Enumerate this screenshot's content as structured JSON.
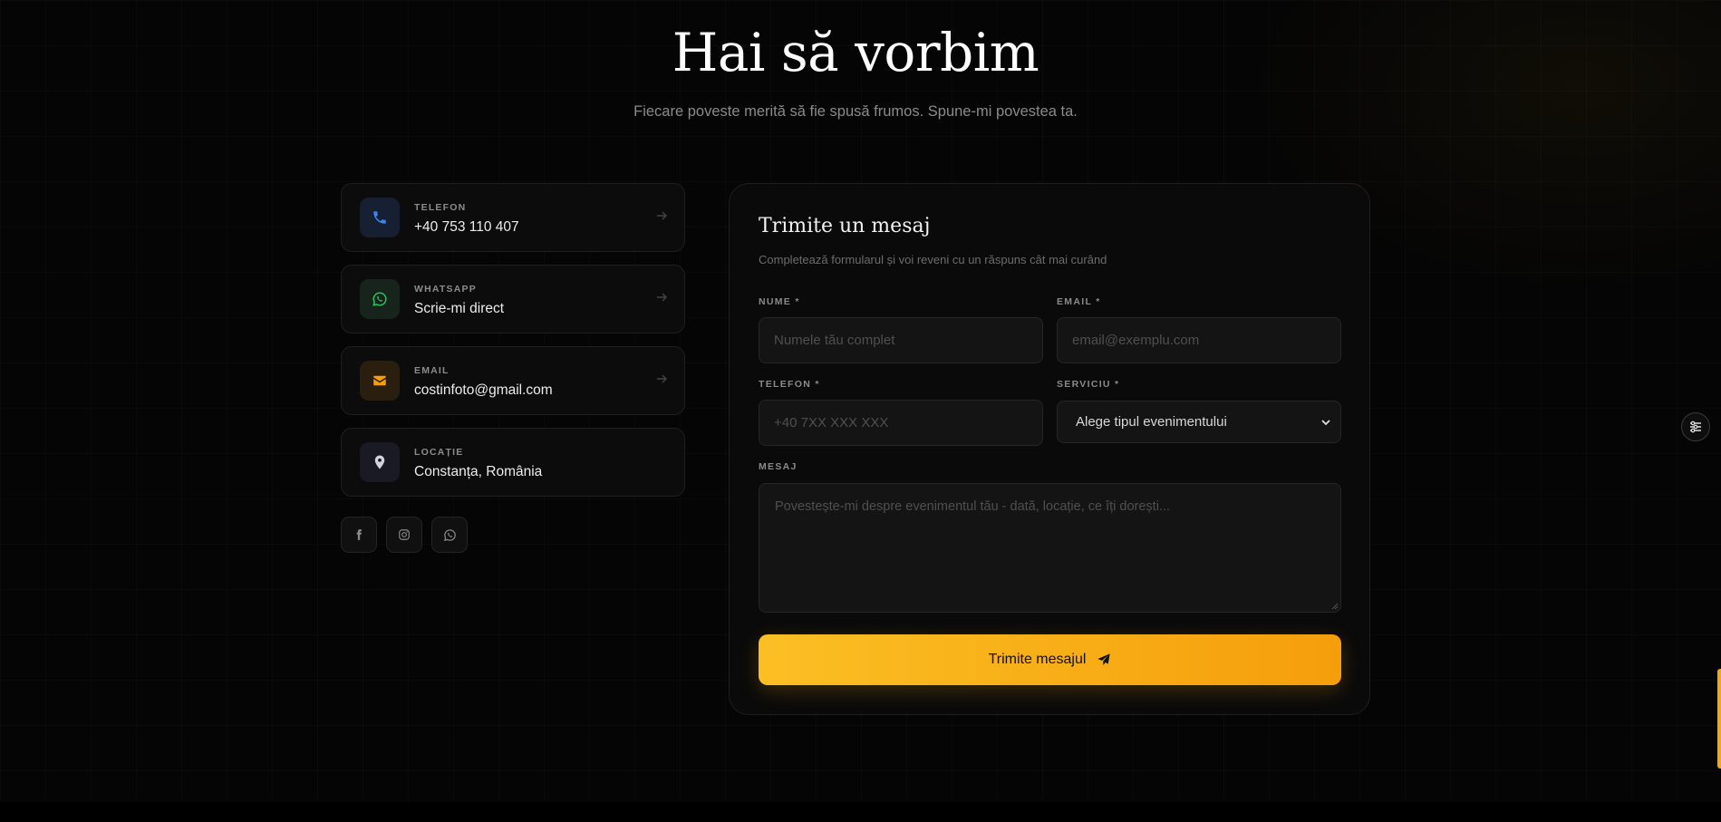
{
  "header": {
    "title": "Hai să vorbim",
    "subtitle": "Fiecare poveste merită să fie spusă frumos. Spune-mi povestea ta."
  },
  "contacts": [
    {
      "label": "TELEFON",
      "value": "+40 753 110 407",
      "icon": "phone-icon",
      "accent": "#3b82f6",
      "has_arrow": true
    },
    {
      "label": "WHATSAPP",
      "value": "Scrie-mi direct",
      "icon": "whatsapp-icon",
      "accent": "#22c55e",
      "has_arrow": true
    },
    {
      "label": "EMAIL",
      "value": "costinfoto@gmail.com",
      "icon": "mail-icon",
      "accent": "#f59e0b",
      "has_arrow": true
    },
    {
      "label": "LOCAȚIE",
      "value": "Constanța, România",
      "icon": "map-pin-icon",
      "accent": "#c7c7d6",
      "has_arrow": false
    }
  ],
  "socials": [
    "facebook-icon",
    "instagram-icon",
    "whatsapp-icon"
  ],
  "form": {
    "title": "Trimite un mesaj",
    "subtitle": "Completează formularul și voi reveni cu un răspuns cât mai curând",
    "name_label": "NUME *",
    "name_placeholder": "Numele tău complet",
    "email_label": "EMAIL *",
    "email_placeholder": "email@exemplu.com",
    "phone_label": "TELEFON *",
    "phone_placeholder": "+40 7XX XXX XXX",
    "service_label": "SERVICIU *",
    "service_selected": "Alege tipul evenimentului",
    "message_label": "MESAJ",
    "message_placeholder": "Povestește-mi despre evenimentul tău - dată, locație, ce îți dorești...",
    "submit_label": "Trimite mesajul"
  },
  "colors": {
    "background": "#050505",
    "accent": "#f59e0b",
    "accent_light": "#fbbf24"
  }
}
